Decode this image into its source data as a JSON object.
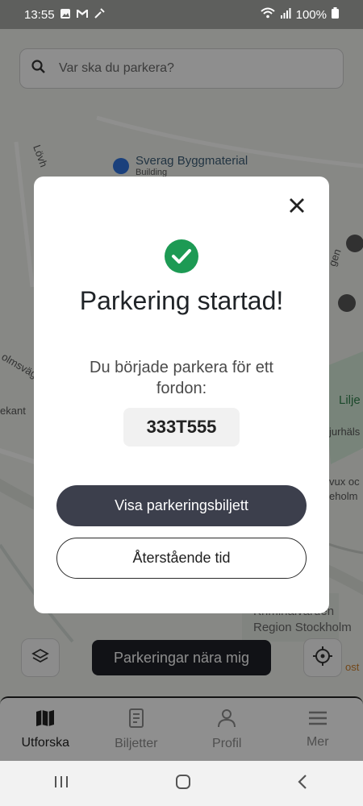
{
  "status_bar": {
    "time": "13:55",
    "battery": "100%",
    "left_icons": [
      "gallery-icon",
      "gmail-icon",
      "tool-icon"
    ],
    "right_icons": [
      "wifi-icon",
      "signal-icon",
      "battery-icon"
    ]
  },
  "search": {
    "placeholder": "Var ska du parkera?"
  },
  "map": {
    "labels": {
      "poi_building": "Sverag Byggmaterial",
      "poi_building_sub": "Building",
      "lilje": "Lilje",
      "jurhals": "jurhäls",
      "vux": "vux oc",
      "heholm": "eholm",
      "kriminal": "Kriminalvården",
      "region": "Region Stockholm",
      "lovh": "Lövh",
      "ekant": "ekant",
      "olmsv": "olmsväg",
      "ost": "ost",
      "gen": "gen"
    }
  },
  "map_controls": {
    "nearby_label": "Parkeringar nära mig"
  },
  "bottom_nav": {
    "items": [
      {
        "label": "Utforska",
        "icon": "map-icon"
      },
      {
        "label": "Biljetter",
        "icon": "ticket-icon"
      },
      {
        "label": "Profil",
        "icon": "profile-icon"
      },
      {
        "label": "Mer",
        "icon": "menu-icon"
      }
    ]
  },
  "modal": {
    "title": "Parkering startad!",
    "description": "Du började parkera för ett fordon:",
    "plate": "333T555",
    "primary_button": "Visa parkeringsbiljett",
    "secondary_button": "Återstående tid"
  },
  "colors": {
    "accent_green": "#1d9a54",
    "primary_button": "#3c3f4c"
  }
}
